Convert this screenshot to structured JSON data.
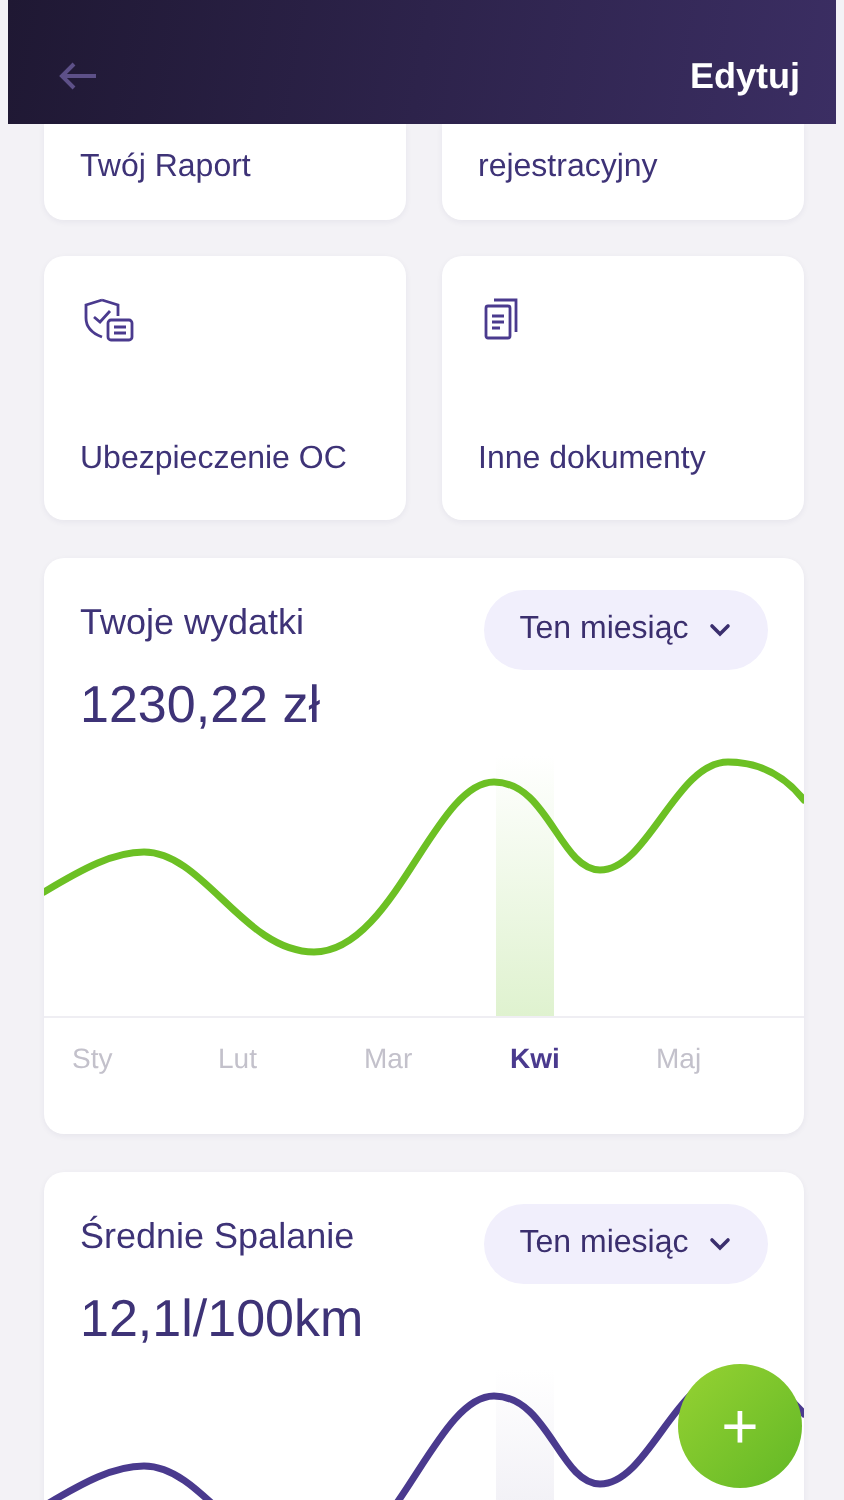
{
  "header": {
    "action": "Edytuj"
  },
  "documents": [
    {
      "label": "Twój Raport"
    },
    {
      "label": "rejestracyjny"
    },
    {
      "label": "Ubezpieczenie OC",
      "kind": "shield"
    },
    {
      "label": "Inne dokumenty",
      "kind": "stack"
    }
  ],
  "stats": [
    {
      "kind": "spending",
      "title": "Twoje wydatki",
      "period": "Ten miesiąc",
      "value": "1230,22 zł",
      "months": [
        {
          "label": "Sty",
          "selected": false
        },
        {
          "label": "Lut",
          "selected": false
        },
        {
          "label": "Mar",
          "selected": false
        },
        {
          "label": "Kwi",
          "selected": true
        },
        {
          "label": "Maj",
          "selected": false
        }
      ]
    },
    {
      "kind": "fuel",
      "title": "Średnie Spalanie",
      "period": "Ten miesiąc",
      "value": "12,1l/100km"
    }
  ],
  "fab": {
    "label": "+"
  }
}
